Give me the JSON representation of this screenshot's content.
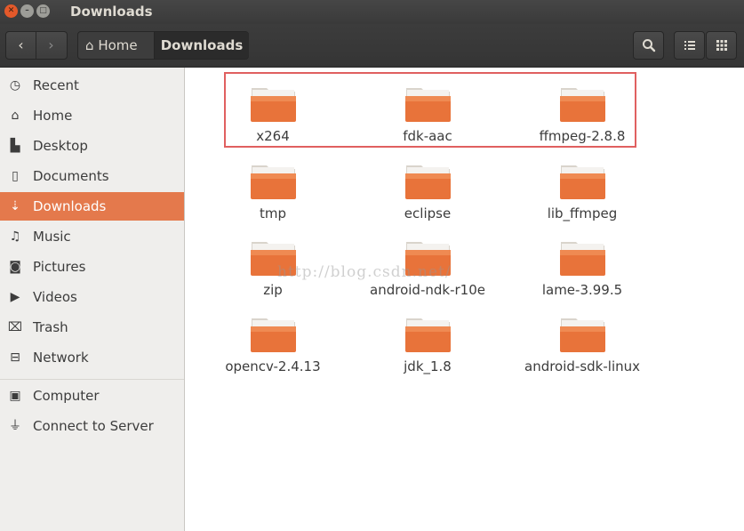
{
  "window": {
    "title": "Downloads"
  },
  "toolbar": {
    "path": [
      {
        "label": "Home",
        "icon": "home-icon"
      },
      {
        "label": "Downloads"
      }
    ],
    "buttons": [
      "search-icon",
      "list-view-icon",
      "grid-view-icon"
    ]
  },
  "sidebar": {
    "items": [
      {
        "label": "Recent",
        "icon": "clock-icon"
      },
      {
        "label": "Home",
        "icon": "home-icon"
      },
      {
        "label": "Desktop",
        "icon": "folder-icon"
      },
      {
        "label": "Documents",
        "icon": "document-icon"
      },
      {
        "label": "Downloads",
        "icon": "download-icon",
        "active": true
      },
      {
        "label": "Music",
        "icon": "music-icon"
      },
      {
        "label": "Pictures",
        "icon": "camera-icon"
      },
      {
        "label": "Videos",
        "icon": "video-icon"
      },
      {
        "label": "Trash",
        "icon": "trash-icon"
      },
      {
        "label": "Network",
        "icon": "network-icon"
      },
      {
        "label": "Computer",
        "icon": "computer-icon"
      },
      {
        "label": "Connect to Server",
        "icon": "server-icon"
      }
    ]
  },
  "files": [
    {
      "name": "x264"
    },
    {
      "name": "fdk-aac"
    },
    {
      "name": "ffmpeg-2.8.8"
    },
    {
      "name": "tmp"
    },
    {
      "name": "eclipse"
    },
    {
      "name": "lib_ffmpeg"
    },
    {
      "name": "zip"
    },
    {
      "name": "android-ndk-r10e"
    },
    {
      "name": "lame-3.99.5"
    },
    {
      "name": "opencv-2.4.13"
    },
    {
      "name": "jdk_1.8"
    },
    {
      "name": "android-sdk-linux"
    }
  ],
  "watermark": "http://blog.csdn.net/",
  "colors": {
    "accent": "#e4794c",
    "folder": "#e8733a",
    "selection_box": "#e06060"
  }
}
